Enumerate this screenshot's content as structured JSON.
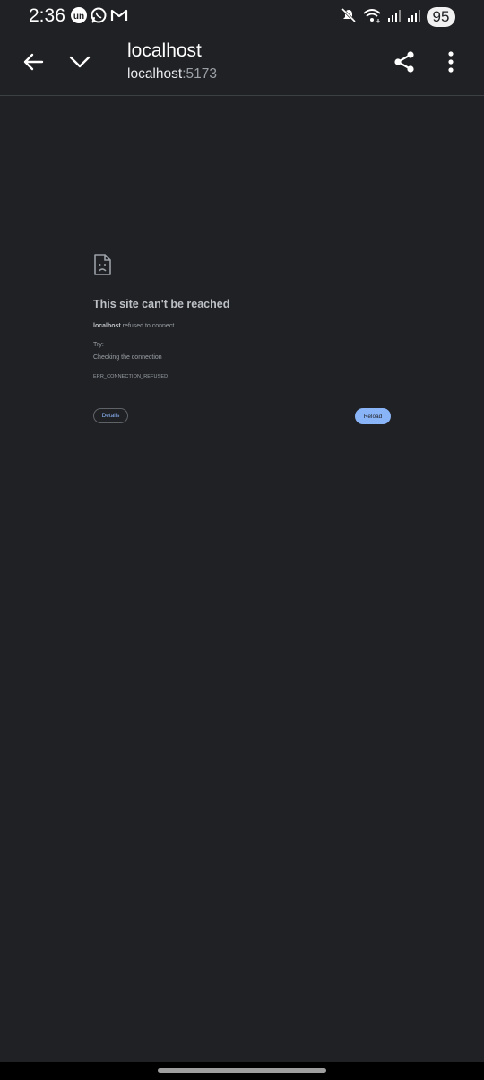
{
  "status_bar": {
    "time": "2:36",
    "battery": "95",
    "notification_icons": [
      "un-app-icon",
      "whatsapp-icon",
      "gmail-icon"
    ],
    "system_icons": [
      "mute-icon",
      "wifi-icon",
      "signal-icon",
      "signal-icon"
    ]
  },
  "toolbar": {
    "title": "localhost",
    "url_host": "localhost",
    "url_port": ":5173"
  },
  "error_page": {
    "heading": "This site can't be reached",
    "host": "localhost",
    "message": " refused to connect.",
    "try_label": "Try:",
    "suggestion": "Checking the connection",
    "error_code": "ERR_CONNECTION_REFUSED",
    "details_label": "Details",
    "reload_label": "Reload"
  },
  "colors": {
    "background": "#202124",
    "accent": "#8ab4f8",
    "text_primary": "#e8eaed",
    "text_secondary": "#9aa0a6"
  }
}
